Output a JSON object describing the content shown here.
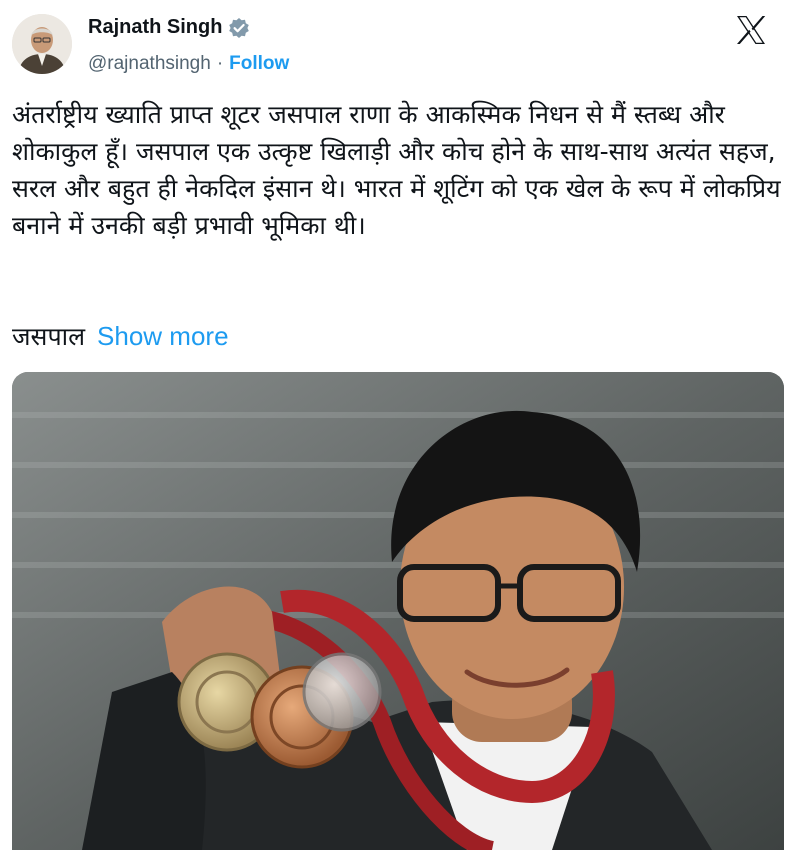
{
  "author": {
    "name": "Rajnath Singh",
    "handle": "@rajnathsingh",
    "separator": "·",
    "follow_label": "Follow",
    "verified_icon": "verified-badge-icon",
    "verified_color": "#829aab"
  },
  "platform": {
    "logo_icon": "x-logo-icon"
  },
  "tweet": {
    "text": "अंतर्राष्ट्रीय ख्याति प्राप्त शूटर जसपाल राणा के आकस्मिक निधन से मैं स्तब्ध और शोकाकुल हूँ। जसपाल एक उत्कृष्ट खिलाड़ी और कोच होने के साथ-साथ अत्यंत सहज, सरल और बहुत ही नेकदिल इंसान थे। भारत में शूटिंग को एक खेल के रूप में लोकप्रिय बनाने में उनकी बड़ी प्रभावी भूमिका थी।",
    "tail_text": "जसपाल",
    "show_more_label": "Show more"
  },
  "colors": {
    "accent": "#1d9bf0",
    "text_primary": "#0f1419",
    "text_secondary": "#536471"
  }
}
